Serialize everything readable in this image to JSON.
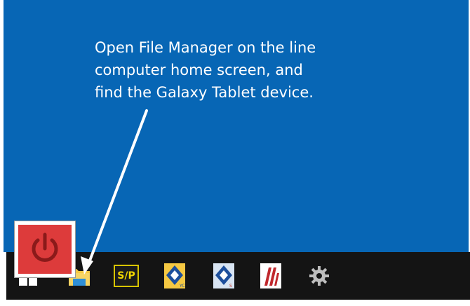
{
  "instruction": {
    "lines": [
      "Open File Manager on the line",
      "computer home screen, and",
      "find the Galaxy Tablet device."
    ]
  },
  "taskbar": {
    "icons": [
      {
        "name": "windows-start-icon"
      },
      {
        "name": "file-manager-icon"
      },
      {
        "name": "sp-app-icon",
        "label": "S/P"
      },
      {
        "name": "yc-app-icon"
      },
      {
        "name": "s-app-icon"
      },
      {
        "name": "red-logo-app-icon"
      },
      {
        "name": "gear-settings-icon"
      }
    ]
  },
  "colors": {
    "desktop": "#0766b5",
    "taskbar": "#141414",
    "text": "#ffffff",
    "arrow": "#ffffff",
    "power_tile": "#dd3b3b",
    "folder": "#f5c842",
    "sp_text": "#f2d600"
  }
}
